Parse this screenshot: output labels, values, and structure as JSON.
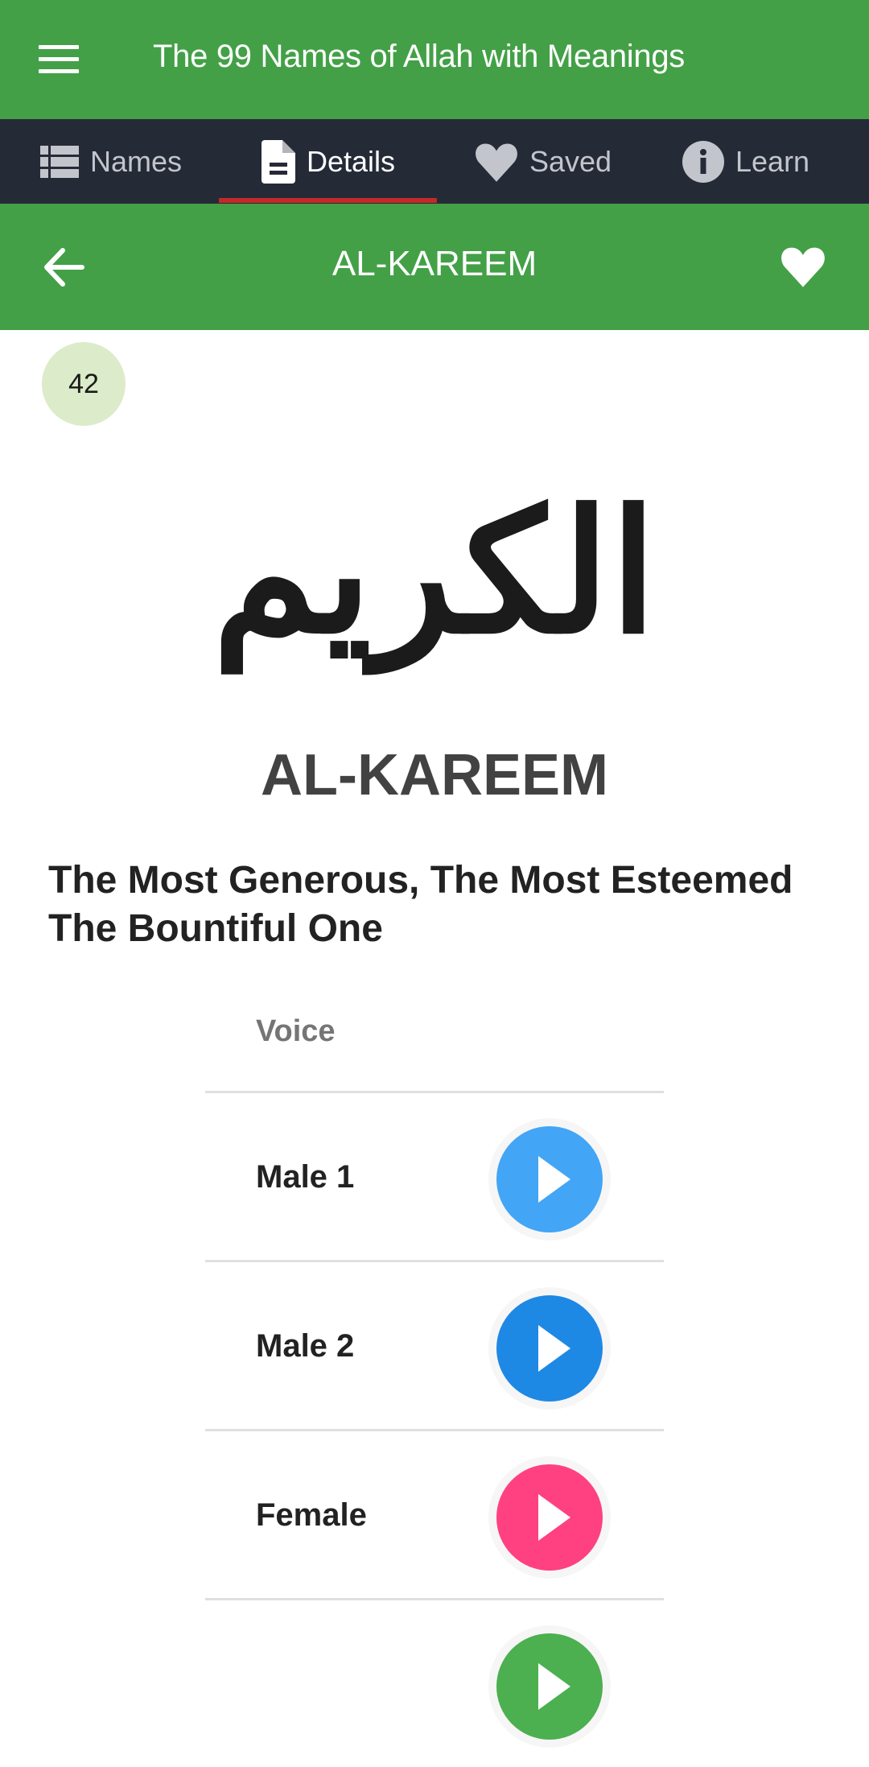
{
  "appbar": {
    "title": "The 99 Names of Allah with Meanings",
    "menu_icon": "hamburger-menu-icon"
  },
  "tabs": [
    {
      "label": "Names",
      "icon": "list-icon",
      "active": false
    },
    {
      "label": "Details",
      "icon": "document-icon",
      "active": true
    },
    {
      "label": "Saved",
      "icon": "heart-icon",
      "active": false
    },
    {
      "label": "Learn",
      "icon": "info-icon",
      "active": false
    }
  ],
  "subbar": {
    "title": "AL-KAREEM",
    "back_icon": "arrow-back-icon",
    "favorite_icon": "heart-icon"
  },
  "detail": {
    "number": "42",
    "arabic": "الكريم",
    "name": "AL-KAREEM",
    "meaning_lines": [
      "The Most Generous, The Most Esteemed",
      "The Bountiful One"
    ]
  },
  "voice": {
    "header": "Voice",
    "rows": [
      {
        "label": "Male 1",
        "color": "#42A5F5"
      },
      {
        "label": "Male 2",
        "color": "#1E88E5"
      },
      {
        "label": "Female",
        "color": "#FF4081"
      },
      {
        "label": "",
        "color": "#4CAF50"
      }
    ]
  },
  "colors": {
    "primary": "#43A047",
    "tabbar": "#252a37",
    "tab_indicator": "#c62828",
    "badge": "#dcebc9"
  }
}
